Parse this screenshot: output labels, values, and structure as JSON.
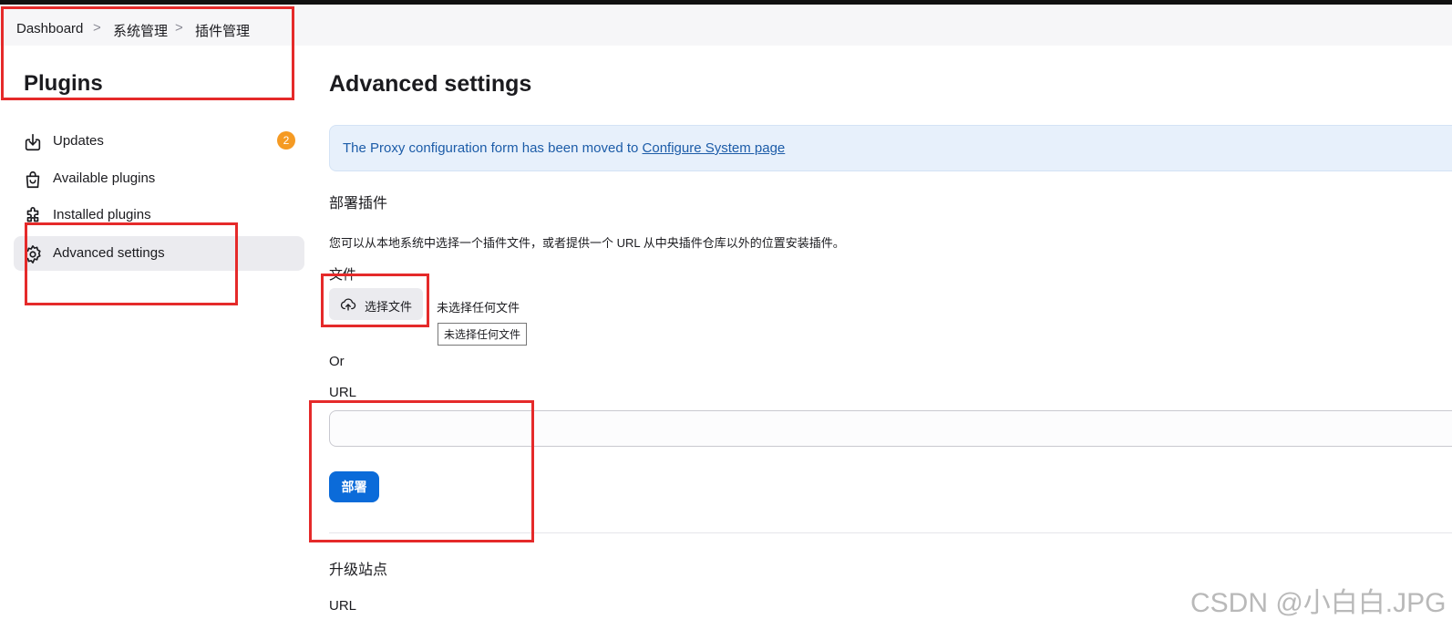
{
  "breadcrumb": {
    "items": [
      "Dashboard",
      "系统管理",
      "插件管理"
    ],
    "separator": ">"
  },
  "sidebar": {
    "title": "Plugins",
    "items": [
      {
        "label": "Updates",
        "icon": "download-icon",
        "badge": "2"
      },
      {
        "label": "Available plugins",
        "icon": "shopping-bag-icon"
      },
      {
        "label": "Installed plugins",
        "icon": "puzzle-icon"
      },
      {
        "label": "Advanced settings",
        "icon": "gear-icon",
        "active": true
      }
    ]
  },
  "main": {
    "title": "Advanced settings",
    "notice": {
      "text": "The Proxy configuration form has been moved to ",
      "link": "Configure System page"
    },
    "deploy": {
      "title": "部署插件",
      "help": "您可以从本地系统中选择一个插件文件，或者提供一个 URL 从中央插件仓库以外的位置安装插件。",
      "file_label": "文件",
      "file_button": "选择文件",
      "file_status": "未选择任何文件",
      "file_tooltip": "未选择任何文件",
      "or_label": "Or",
      "url_label": "URL",
      "url_value": "",
      "submit_label": "部署"
    },
    "update_site": {
      "title": "升级站点",
      "url_label": "URL"
    }
  },
  "watermark": "CSDN @小白白.JPG",
  "colors": {
    "accent": "#0b6bd9",
    "badge": "#f59a23",
    "notice_bg": "#e7f0fb",
    "annotation": "#e52a2a"
  }
}
